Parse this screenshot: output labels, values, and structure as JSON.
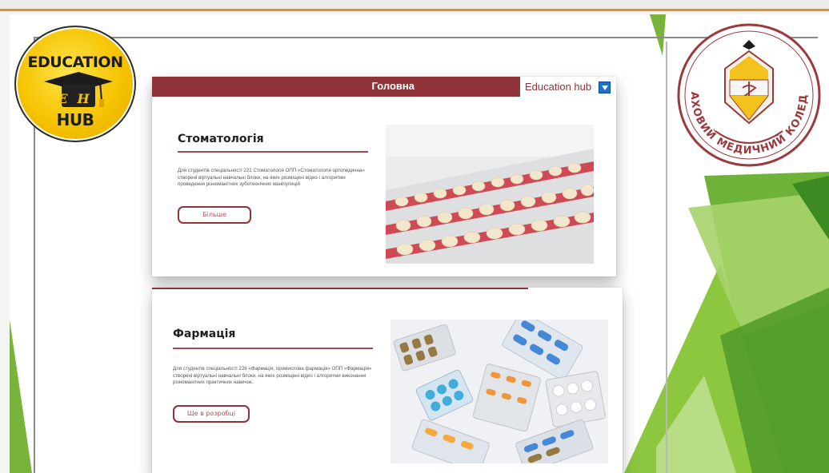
{
  "brand": {
    "eh_logo_top": "EDUCATION",
    "eh_logo_initials": "EH",
    "eh_logo_bottom": "HUB",
    "college_arc_text": "ФАХОВИЙ МЕДИЧНИЙ КОЛЕДЖ"
  },
  "nav": {
    "home_label": "Головна",
    "hub_label": "Education hub",
    "dropdown_icon": "triangle-down-icon"
  },
  "cards": [
    {
      "title": "Стоматологія",
      "description": "Для студентів спеціальності 221 Стоматологія ОПП «Стоматологія ортопедична» створені віртуальні навчальні блоки, на яких розміщені відео і алгоритми проведення різноманітних зуботехнічних маніпуляцій",
      "button_label": "Більше",
      "image": "dental-teeth-photo"
    },
    {
      "title": "Фармація",
      "description": "Для студентів спеціальності 226 «Фармація, промислова фармація» ОПП «Фармація» створені віртуальні навчальні блоки, на яких розміщені відео і алгоритми виконання різноманітних практичних навичок.",
      "button_label": "Ще в розробці",
      "image": "pill-blisters-photo"
    }
  ],
  "colors": {
    "accent": "#8e3338",
    "dropdown": "#1e73c8",
    "green": "#6cb33f",
    "orange_strip": "#f0892b"
  }
}
